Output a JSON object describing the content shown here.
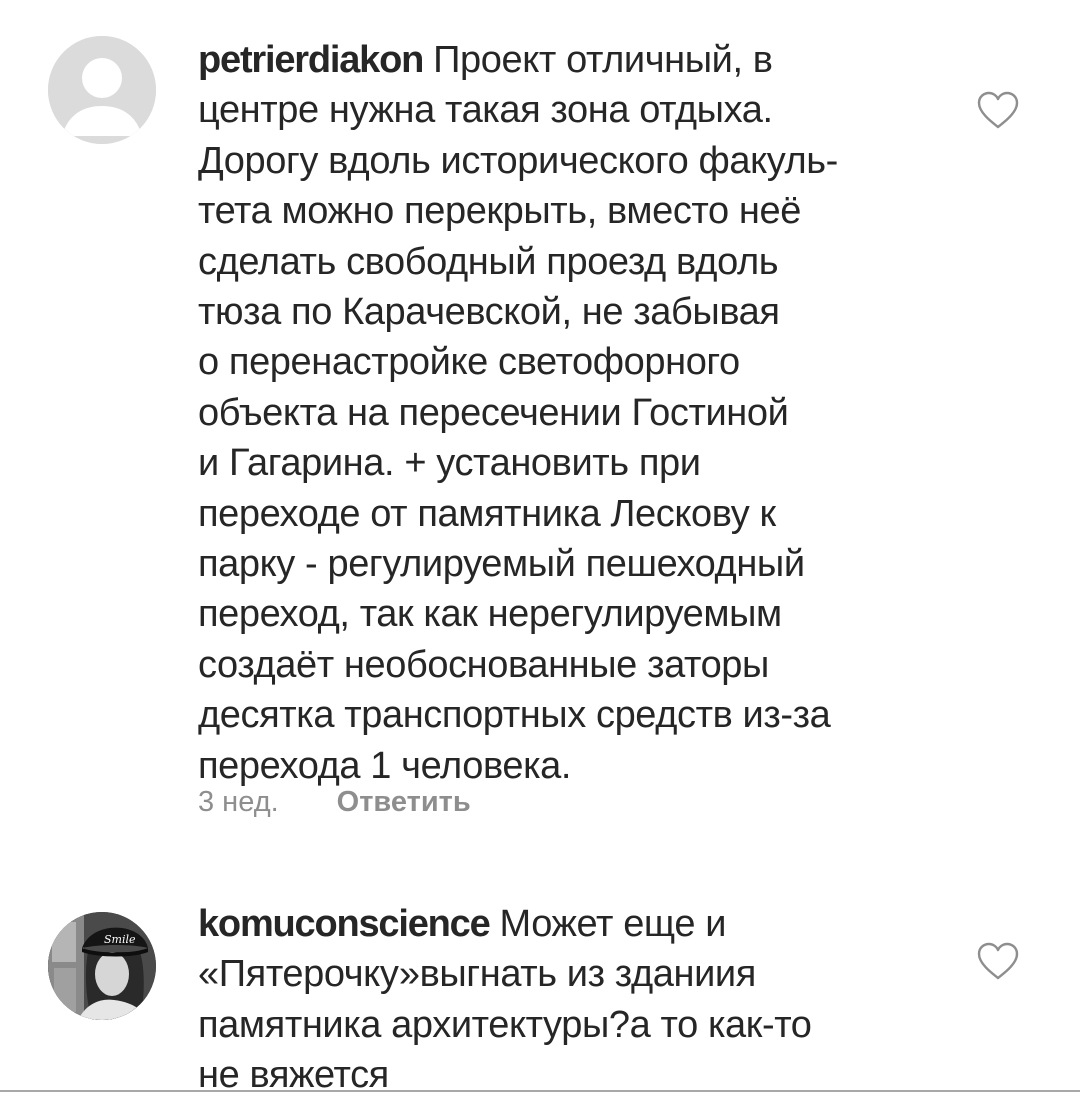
{
  "comments": [
    {
      "username": "petrierdiakon",
      "text": "Проект отличный, в\nцентре нужна такая зона отдыха.\nДорогу вдоль исторического факуль-\nтета можно перекрыть, вместо неё\nсделать свободный проезд вдоль\nтюза по Карачевской, не забывая\nо перенастройке светофорного\nобъекта на пересечении Гостиной\nи Гагарина. + установить при\nпереходе от памятника Лескову к\nпарку - регулируемый пешеходный\nпереход, так как нерегулируемым\nсоздаёт необоснованные заторы\nдесятка транспортных средств из-за\nперехода 1 человека.",
      "time": "3 нед.",
      "reply_label": "Ответить",
      "avatar": "default-avatar-silhouette",
      "like_icon": "heart-outline-icon"
    },
    {
      "username": "komuconscience",
      "text": "Может еще и\n«Пятерочку»выгнать из зданиия\nпамятника архитектуры?а то как-то\nне вяжется",
      "avatar": "user-photo-avatar",
      "avatar_cap_text": "Smile",
      "like_icon": "heart-outline-icon"
    }
  ],
  "colors": {
    "text": "#262626",
    "secondary_text": "#8e8e8e",
    "icon": "#8e8e8e",
    "default_avatar_bg": "#dbdbdb"
  }
}
